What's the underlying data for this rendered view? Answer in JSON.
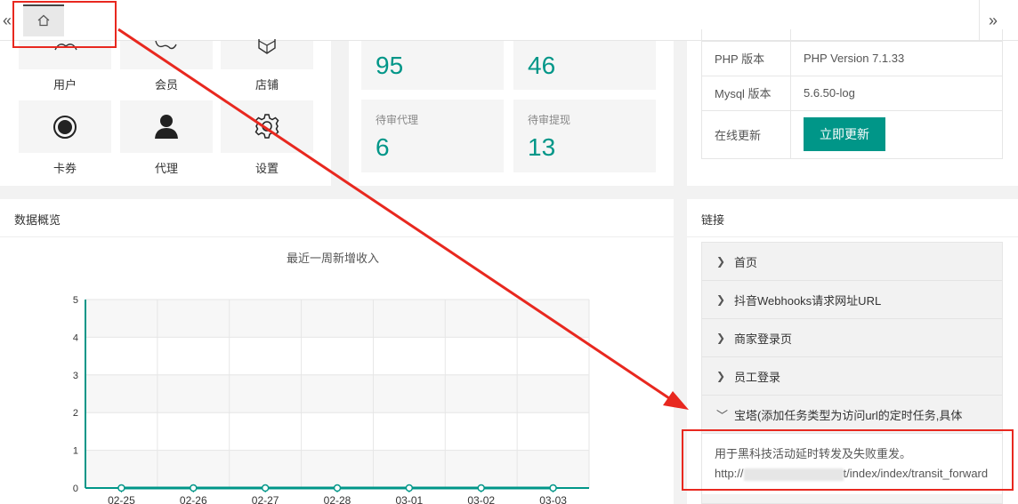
{
  "tabbar": {
    "prev_icon": "«",
    "next_icon": "»",
    "home_icon": "home-icon"
  },
  "shortcuts": [
    {
      "label": "用户",
      "icon": "users-icon"
    },
    {
      "label": "会员",
      "icon": "member-icon"
    },
    {
      "label": "店铺",
      "icon": "store-icon"
    },
    {
      "label": "卡券",
      "icon": "coupon-icon"
    },
    {
      "label": "代理",
      "icon": "agent-icon"
    },
    {
      "label": "设置",
      "icon": "gear-icon"
    }
  ],
  "stats": [
    {
      "label": "",
      "value": "95"
    },
    {
      "label": "",
      "value": "46"
    },
    {
      "label": "待审代理",
      "value": "6"
    },
    {
      "label": "待审提现",
      "value": "13"
    }
  ],
  "info": {
    "rows": [
      {
        "key": "PHP 版本",
        "value": "PHP Version 7.1.33"
      },
      {
        "key": "Mysql 版本",
        "value": "5.6.50-log"
      }
    ],
    "update_key": "在线更新",
    "update_button": "立即更新"
  },
  "overview": {
    "title": "数据概览"
  },
  "links": {
    "title": "链接",
    "items": [
      {
        "label": "首页"
      },
      {
        "label": "抖音Webhooks请求网址URL"
      },
      {
        "label": "商家登录页"
      },
      {
        "label": "员工登录"
      },
      {
        "label": "宝塔(添加任务类型为访问url的定时任务,具体"
      }
    ],
    "expanded_text": "用于黑科技活动延时转发及失败重发。",
    "url_prefix": "http://",
    "url_suffix": "t/index/index/transit_forward"
  },
  "colors": {
    "accent": "#009688",
    "annotation": "#e8281f"
  },
  "chart_data": {
    "type": "line",
    "title": "最近一周新增收入",
    "categories": [
      "02-25",
      "02-26",
      "02-27",
      "02-28",
      "03-01",
      "03-02",
      "03-03"
    ],
    "series": [
      {
        "values": [
          0,
          0,
          0,
          0,
          0,
          0,
          0
        ]
      }
    ],
    "yticks": [
      "0",
      "1",
      "2",
      "3",
      "4",
      "5"
    ],
    "ylim": [
      0,
      5
    ],
    "grid": true,
    "xlabel": "",
    "ylabel": ""
  }
}
